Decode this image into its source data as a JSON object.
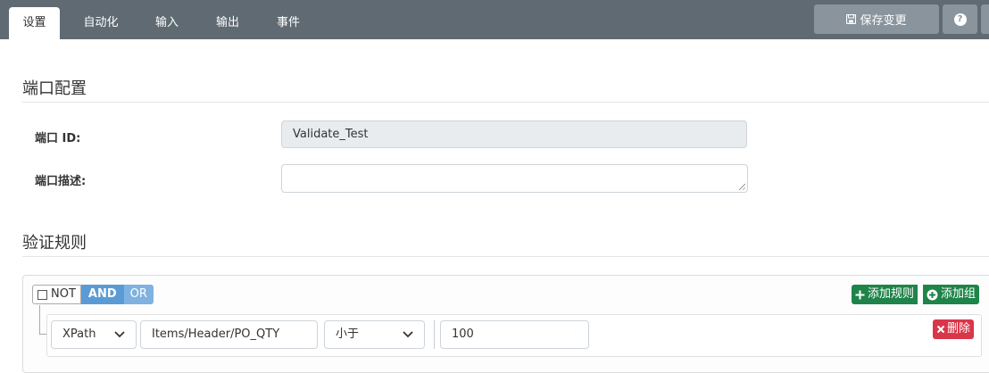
{
  "tabs": [
    "设置",
    "自动化",
    "输入",
    "输出",
    "事件"
  ],
  "toolbar": {
    "save_label": "保存变更",
    "help_label": "?"
  },
  "sections": {
    "port_config": "端口配置",
    "validation_rules": "验证规则"
  },
  "form": {
    "port_id_label": "端口 ID:",
    "port_id_value": "Validate_Test",
    "port_desc_label": "端口描述:",
    "port_desc_value": ""
  },
  "rules": {
    "not_label": "NOT",
    "and_label": "AND",
    "or_label": "OR",
    "add_rule_label": "添加规则",
    "add_group_label": "添加组",
    "row": {
      "field_type": "XPath",
      "path": "Items/Header/PO_QTY",
      "operator": "小于",
      "value": "100",
      "delete_label": "删除"
    }
  },
  "colors": {
    "topbar": "#5f6a72",
    "accent_blue": "#5b9bd5",
    "green": "#1e8449",
    "red": "#d9364a"
  }
}
